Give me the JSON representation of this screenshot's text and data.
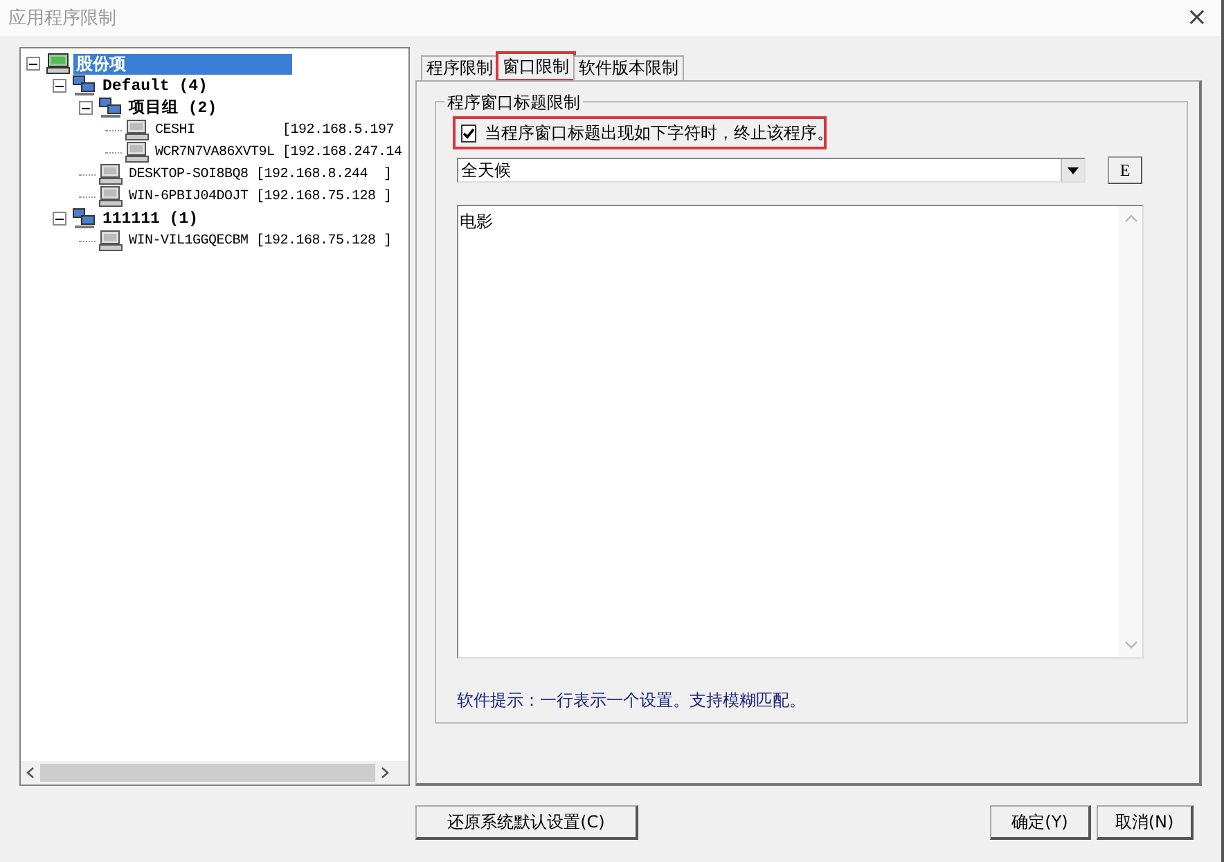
{
  "window": {
    "title": "应用程序限制",
    "close": "×"
  },
  "tree": {
    "items": [
      {
        "kind": "root",
        "label": "股份项",
        "selected": true,
        "expanded": true,
        "children": [
          {
            "kind": "group",
            "label": "Default (4)",
            "selected": false,
            "expanded": true,
            "children": [
              {
                "kind": "group",
                "label": "项目组 (2)",
                "selected": false,
                "expanded": true,
                "children": [
                  {
                    "kind": "computer",
                    "label": "CESHI           [192.168.5.197",
                    "selected": false
                  },
                  {
                    "kind": "computer",
                    "label": "WCR7N7VA86XVT9L [192.168.247.14",
                    "selected": false
                  }
                ]
              },
              {
                "kind": "computer",
                "label": "DESKTOP-SOI8BQ8 [192.168.8.244  ]",
                "selected": false
              },
              {
                "kind": "computer",
                "label": "WIN-6PBIJ04DOJT [192.168.75.128 ]",
                "selected": false
              }
            ]
          },
          {
            "kind": "group",
            "label": "111111 (1)",
            "selected": false,
            "expanded": true,
            "children": [
              {
                "kind": "computer",
                "label": "WIN-VIL1GGQECBM [192.168.75.128 ]",
                "selected": false
              }
            ]
          }
        ]
      }
    ]
  },
  "tabs": [
    {
      "label": "程序限制",
      "selected": false,
      "highlighted": false
    },
    {
      "label": "窗口限制",
      "selected": true,
      "highlighted": true
    },
    {
      "label": "软件版本限制",
      "selected": false,
      "highlighted": false
    }
  ],
  "group": {
    "title": "程序窗口标题限制",
    "checkbox": {
      "label": "当程序窗口标题出现如下字符时，终止该程序。",
      "checked": true,
      "highlighted": true
    },
    "dropdown": {
      "value": "全天候"
    },
    "side_button": "E",
    "text_area": {
      "value": "电影"
    },
    "hint": "软件提示：一行表示一个设置。支持模糊匹配。"
  },
  "buttons": {
    "restore": "还原系统默认设置(C)",
    "ok": "确定(Y)",
    "cancel": "取消(N)"
  }
}
